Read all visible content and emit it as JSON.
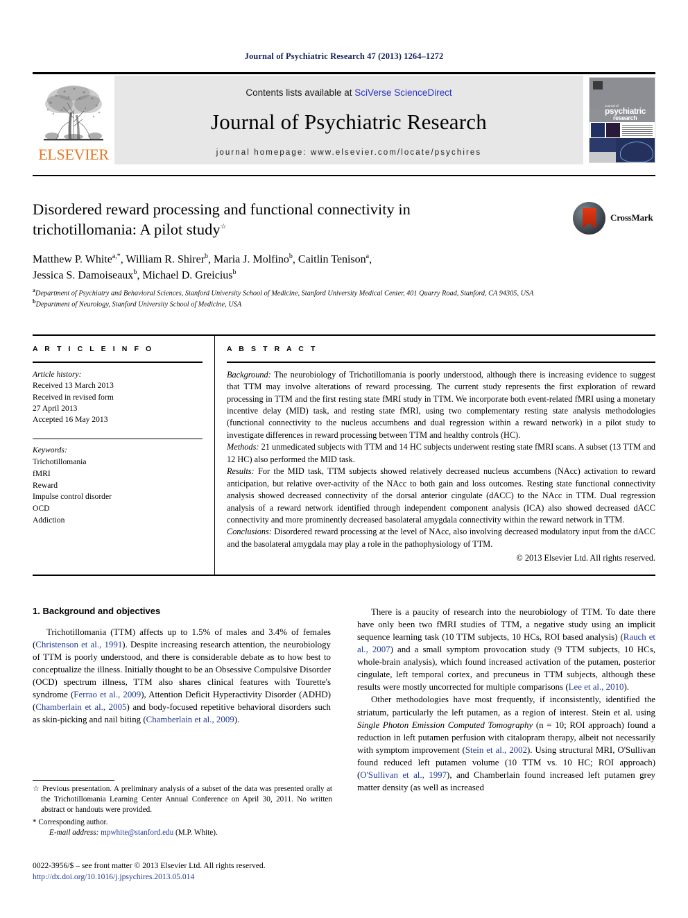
{
  "running_head": "Journal of Psychiatric Research 47 (2013) 1264–1272",
  "masthead": {
    "publisher_name": "ELSEVIER",
    "contents_prefix": "Contents lists available at ",
    "contents_link": "SciVerse ScienceDirect",
    "journal_title": "Journal of Psychiatric Research",
    "homepage": "journal homepage: www.elsevier.com/locate/psychires",
    "cover": {
      "line1_small": "Journal of",
      "line1": "psychiatric",
      "line2": "research"
    }
  },
  "crossmark": {
    "label": "CrossMark"
  },
  "article": {
    "title_line1": "Disordered reward processing and functional connectivity in",
    "title_line2": "trichotillomania: A pilot study",
    "title_footnote_mark": "☆",
    "authors_line1": "Matthew P. White",
    "authors": [
      {
        "name": "Matthew P. White",
        "sup": "a,*"
      },
      {
        "name": "William R. Shirer",
        "sup": "b"
      },
      {
        "name": "Maria J. Molfino",
        "sup": "b"
      },
      {
        "name": "Caitlin Tenison",
        "sup": "a"
      },
      {
        "name": "Jessica S. Damoiseaux",
        "sup": "b"
      },
      {
        "name": "Michael D. Greicius",
        "sup": "b"
      }
    ],
    "affiliations": [
      {
        "sup": "a",
        "text": "Department of Psychiatry and Behavioral Sciences, Stanford University School of Medicine, Stanford University Medical Center, 401 Quarry Road, Stanford, CA 94305, USA"
      },
      {
        "sup": "b",
        "text": "Department of Neurology, Stanford University School of Medicine, USA"
      }
    ]
  },
  "article_info": {
    "heading": "A R T I C L E  I N F O",
    "history_label": "Article history:",
    "history": [
      "Received 13 March 2013",
      "Received in revised form",
      "27 April 2013",
      "Accepted 16 May 2013"
    ],
    "keywords_label": "Keywords:",
    "keywords": [
      "Trichotillomania",
      "fMRI",
      "Reward",
      "Impulse control disorder",
      "OCD",
      "Addiction"
    ]
  },
  "abstract": {
    "heading": "A B S T R A C T",
    "sections": [
      {
        "label": "Background:",
        "text": " The neurobiology of Trichotillomania is poorly understood, although there is increasing evidence to suggest that TTM may involve alterations of reward processing. The current study represents the first exploration of reward processing in TTM and the first resting state fMRI study in TTM. We incorporate both event-related fMRI using a monetary incentive delay (MID) task, and resting state fMRI, using two complementary resting state analysis methodologies (functional connectivity to the nucleus accumbens and dual regression within a reward network) in a pilot study to investigate differences in reward processing between TTM and healthy controls (HC)."
      },
      {
        "label": "Methods:",
        "text": " 21 unmedicated subjects with TTM and 14 HC subjects underwent resting state fMRI scans. A subset (13 TTM and 12 HC) also performed the MID task."
      },
      {
        "label": "Results:",
        "text": " For the MID task, TTM subjects showed relatively decreased nucleus accumbens (NAcc) activation to reward anticipation, but relative over-activity of the NAcc to both gain and loss outcomes. Resting state functional connectivity analysis showed decreased connectivity of the dorsal anterior cingulate (dACC) to the NAcc in TTM. Dual regression analysis of a reward network identified through independent component analysis (ICA) also showed decreased dACC connectivity and more prominently decreased basolateral amygdala connectivity within the reward network in TTM."
      },
      {
        "label": "Conclusions:",
        "text": " Disordered reward processing at the level of NAcc, also involving decreased modulatory input from the dACC and the basolateral amygdala may play a role in the pathophysiology of TTM."
      }
    ],
    "copyright": "© 2013 Elsevier Ltd. All rights reserved."
  },
  "body": {
    "section_heading": "1. Background and objectives",
    "left_paragraph_parts": [
      {
        "t": "Trichotillomania (TTM) affects up to 1.5% of males and 3.4% of females (",
        "cite": false
      },
      {
        "t": "Christenson et al., 1991",
        "cite": true
      },
      {
        "t": "). Despite increasing research attention, the neurobiology of TTM is poorly understood, and there is considerable debate as to how best to conceptualize the illness. Initially thought to be an Obsessive Compulsive Disorder (OCD) spectrum illness, TTM also shares clinical features with Tourette's syndrome (",
        "cite": false
      },
      {
        "t": "Ferrao et al., 2009",
        "cite": true
      },
      {
        "t": "), Attention Deficit Hyperactivity Disorder (ADHD) (",
        "cite": false
      },
      {
        "t": "Chamberlain et al., 2005",
        "cite": true
      },
      {
        "t": ") and body-focused repetitive behavioral disorders such as skin-picking and nail biting (",
        "cite": false
      },
      {
        "t": "Chamberlain et al., 2009",
        "cite": true
      },
      {
        "t": ").",
        "cite": false
      }
    ],
    "right_paragraph1_parts": [
      {
        "t": "There is a paucity of research into the neurobiology of TTM. To date there have only been two fMRI studies of TTM, a negative study using an implicit sequence learning task (10 TTM subjects, 10 HCs, ROI based analysis) (",
        "cite": false
      },
      {
        "t": "Rauch et al., 2007",
        "cite": true
      },
      {
        "t": ") and a small symptom provocation study (9 TTM subjects, 10 HCs, whole-brain analysis), which found increased activation of the putamen, posterior cingulate, left temporal cortex, and precuneus in TTM subjects, although these results were mostly uncorrected for multiple comparisons (",
        "cite": false
      },
      {
        "t": "Lee et al., 2010",
        "cite": true
      },
      {
        "t": ").",
        "cite": false
      }
    ],
    "right_paragraph2_parts": [
      {
        "t": "Other methodologies have most frequently, if inconsistently, identified the striatum, particularly the left putamen, as a region of interest. Stein et al. using ",
        "cite": false
      },
      {
        "t": "Single Photon Emission Computed Tomography",
        "italic": true
      },
      {
        "t": " (n = 10; ROI approach) found a reduction in left putamen perfusion with citalopram therapy, albeit not necessarily with symptom improvement (",
        "cite": false
      },
      {
        "t": "Stein et al., 2002",
        "cite": true
      },
      {
        "t": "). Using structural MRI, O'Sullivan found reduced left putamen volume (10 TTM vs. 10 HC; ROI approach) (",
        "cite": false
      },
      {
        "t": "O'Sullivan et al., 1997",
        "cite": true
      },
      {
        "t": "), and Chamberlain found increased left putamen grey matter density (as well as increased",
        "cite": false
      }
    ]
  },
  "footnotes": {
    "star_mark": "☆",
    "star_text": " Previous presentation. A preliminary analysis of a subset of the data was presented orally at the Trichotillomania Learning Center Annual Conference on April 30, 2011. No written abstract or handouts were provided.",
    "corresponding_mark": "*",
    "corresponding_text": " Corresponding author.",
    "email_label": "E-mail address:",
    "email": "mpwhite@stanford.edu",
    "email_suffix": " (M.P. White)."
  },
  "footer": {
    "issn_line": "0022-3956/$ – see front matter © 2013 Elsevier Ltd. All rights reserved.",
    "doi": "http://dx.doi.org/10.1016/j.jpsychires.2013.05.014"
  },
  "colors": {
    "citation_blue": "#1f3a93",
    "link_blue": "#2b35c4",
    "elsevier_orange": "#e87722",
    "banner_gray": "#e7e7e7",
    "running_head_navy": "#12215c"
  }
}
